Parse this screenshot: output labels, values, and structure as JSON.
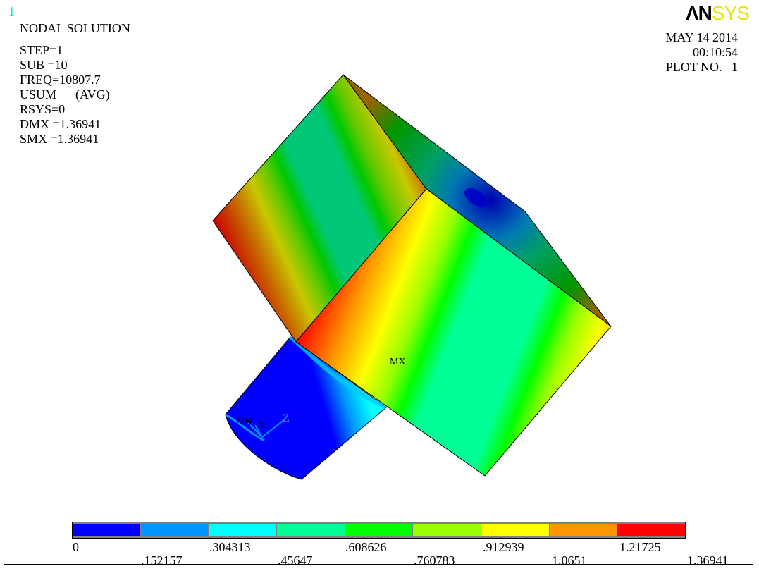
{
  "window": {
    "number": "1"
  },
  "logo": {
    "part1": "ΛN",
    "part2": "SYS"
  },
  "header": {
    "title": "NODAL SOLUTION",
    "lines": [
      "STEP=1",
      "SUB =10",
      "FREQ=10807.7",
      "USUM      (AVG)",
      "RSYS=0",
      "DMX =1.36941",
      "SMX =1.36941"
    ]
  },
  "info": {
    "date": "MAY 14 2014",
    "time": "00:10:54",
    "plot": "PLOT NO.   1"
  },
  "labels": {
    "mx": "MX",
    "mn": "MN",
    "axis_y": "Y",
    "axis_x": "X",
    "axis_z": "Z"
  },
  "legend": {
    "colors": [
      "#0000ff",
      "#0096ff",
      "#00ffff",
      "#00ff96",
      "#00ff00",
      "#96ff00",
      "#ffff00",
      "#ff9600",
      "#ff0000"
    ],
    "ticks_top": [
      "0",
      ".304313",
      ".608626",
      ".912939",
      "1.21725"
    ],
    "ticks_bottom": [
      ".152157",
      ".45647",
      ".760783",
      "1.0651",
      "1.36941"
    ]
  }
}
